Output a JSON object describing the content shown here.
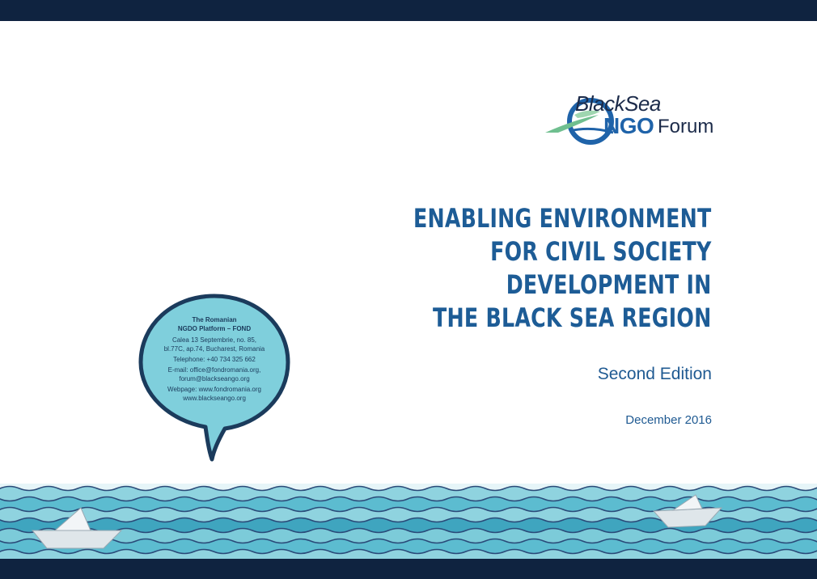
{
  "colors": {
    "navy": "#0f2340",
    "title_blue": "#1d5c96",
    "text_blue": "#1f5a92",
    "bubble_fill": "#7fcfdc",
    "bubble_stroke": "#1b3b5c",
    "wave_light": "#8fd3df",
    "wave_mid": "#3fa5bf",
    "wave_line": "#2a4a78",
    "logo_dark": "#1c2b4a",
    "logo_blue": "#1f63a9"
  },
  "logo": {
    "line1": "BlackSea",
    "ngo": "NGO",
    "forum": "Forum"
  },
  "title": {
    "lines": [
      "ENABLING ENVIRONMENT",
      "FOR CIVIL SOCIETY",
      "DEVELOPMENT IN",
      "THE BLACK SEA REGION"
    ]
  },
  "edition": "Second Edition",
  "date": "December 2016",
  "contact": {
    "org_line1": "The Romanian",
    "org_line2": "NGDO Platform – FOND",
    "address_line1": "Calea 13 Septembrie, no. 85,",
    "address_line2": "bl.77C, ap.74, Bucharest, Romania",
    "telephone": "Telephone: +40 734 325 662",
    "email_line1": "E-mail: office@fondromania.org,",
    "email_line2": "forum@blackseango.org",
    "web_line1": "Webpage: www.fondromania.org",
    "web_line2": "www.blackseango.org"
  },
  "icons": {
    "logo_emblem": "sea-circle-emblem",
    "boat_left": "paper-boat-icon",
    "boat_right": "paper-boat-icon"
  }
}
